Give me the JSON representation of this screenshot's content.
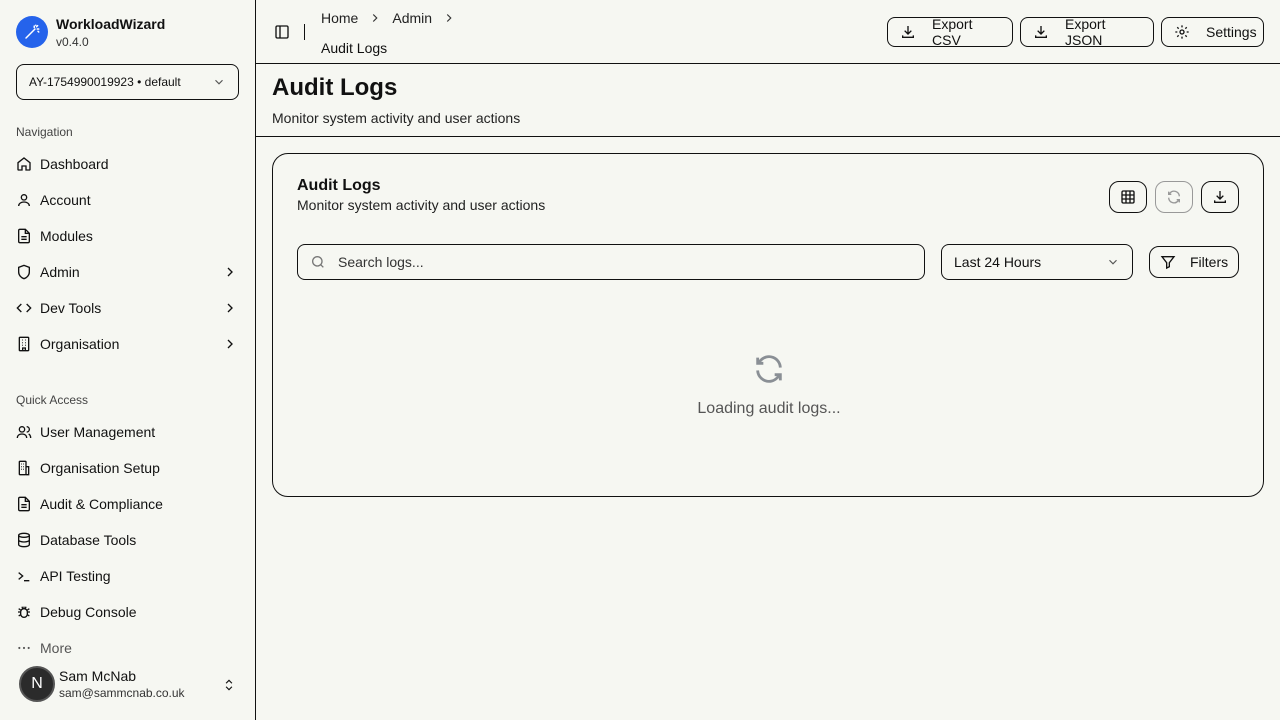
{
  "app": {
    "name": "WorkloadWizard",
    "version": "v0.4.0"
  },
  "project_selector": {
    "value": "AY-1754990019923 • default"
  },
  "sidebar": {
    "navigation_label": "Navigation",
    "nav": [
      {
        "label": "Dashboard",
        "icon": "home-icon"
      },
      {
        "label": "Account",
        "icon": "user-icon"
      },
      {
        "label": "Modules",
        "icon": "file-icon"
      },
      {
        "label": "Admin",
        "icon": "shield-icon",
        "expandable": true
      },
      {
        "label": "Dev Tools",
        "icon": "code-icon",
        "expandable": true
      },
      {
        "label": "Organisation",
        "icon": "building-icon",
        "expandable": true
      }
    ],
    "quick_access_label": "Quick Access",
    "quick": [
      {
        "label": "User Management",
        "icon": "users-icon"
      },
      {
        "label": "Organisation Setup",
        "icon": "building-icon"
      },
      {
        "label": "Audit & Compliance",
        "icon": "file-icon"
      },
      {
        "label": "Database Tools",
        "icon": "database-icon"
      },
      {
        "label": "API Testing",
        "icon": "terminal-icon"
      },
      {
        "label": "Debug Console",
        "icon": "bug-icon"
      }
    ],
    "more_label": "More"
  },
  "user": {
    "name": "Sam McNab",
    "email": "sam@sammcnab.co.uk",
    "avatar_initial": "N"
  },
  "breadcrumb": {
    "items": [
      "Home",
      "Admin"
    ],
    "current": "Audit Logs"
  },
  "toolbar": {
    "export_csv": "Export CSV",
    "export_json": "Export JSON",
    "settings": "Settings"
  },
  "page": {
    "title": "Audit Logs",
    "subtitle": "Monitor system activity and user actions"
  },
  "card": {
    "title": "Audit Logs",
    "subtitle": "Monitor system activity and user actions",
    "search_placeholder": "Search logs...",
    "time_range": "Last 24 Hours",
    "filters_label": "Filters",
    "loading_text": "Loading audit logs..."
  },
  "colors": {
    "brand": "#2563eb",
    "background": "#f6f7f2"
  }
}
